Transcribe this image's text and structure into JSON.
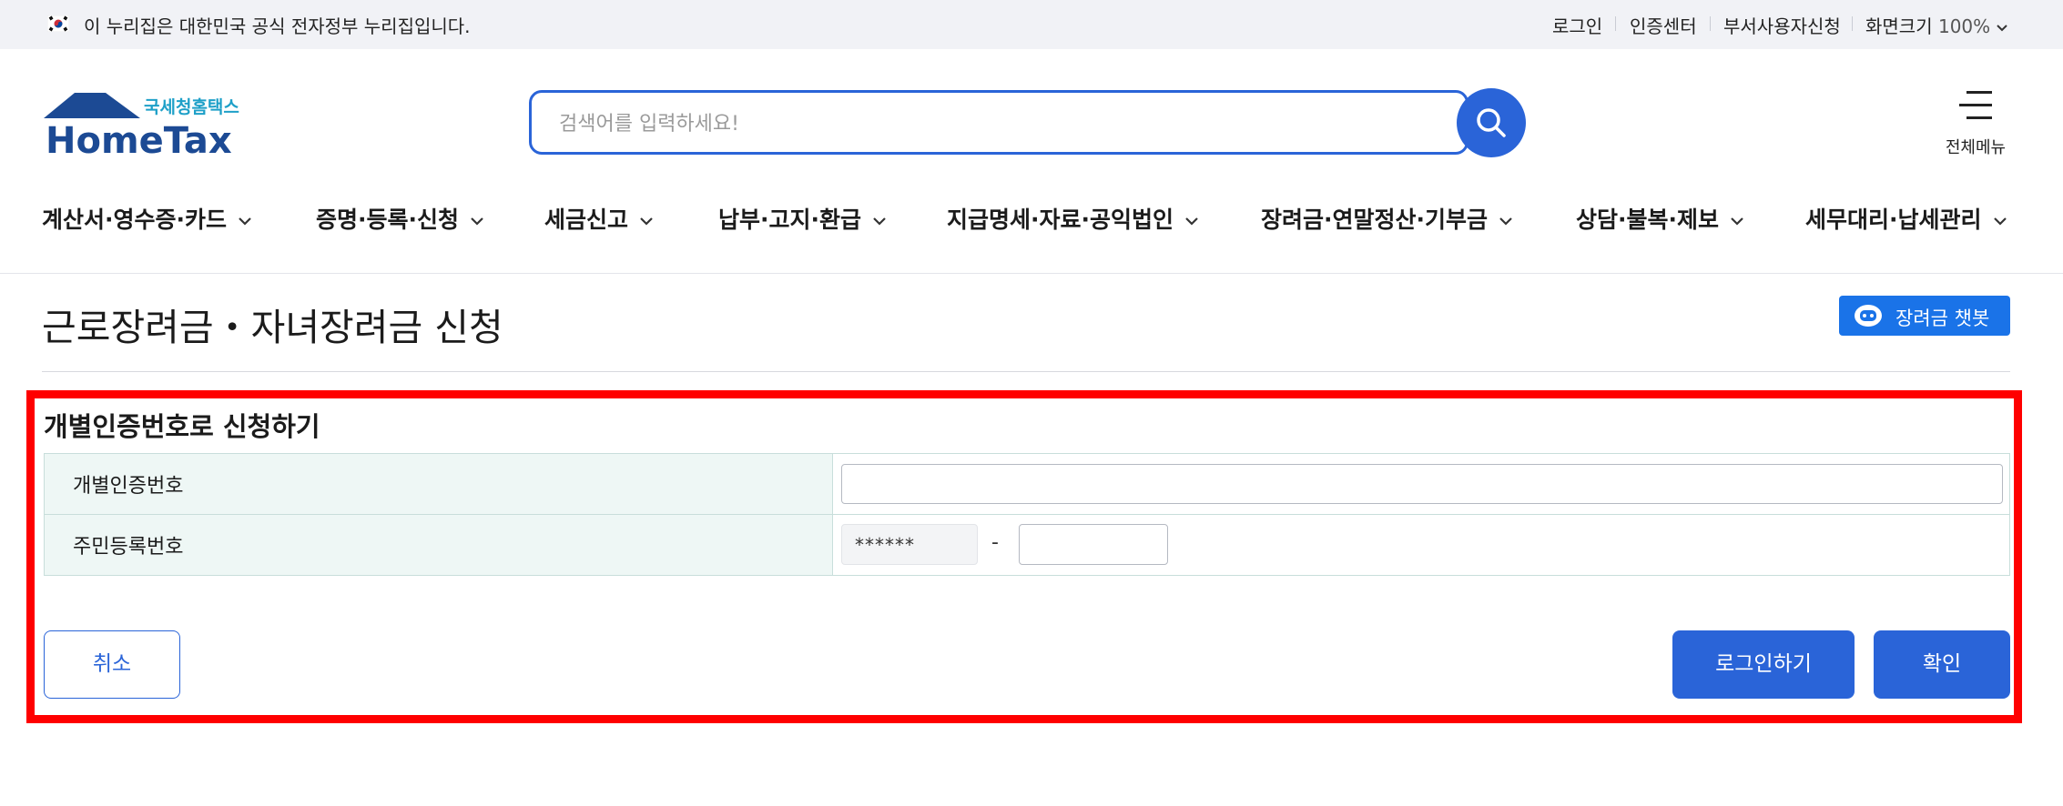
{
  "topbar": {
    "gov_notice": "이 누리집은 대한민국 공식 전자정부 누리집입니다.",
    "links": [
      "로그인",
      "인증센터",
      "부서사용자신청"
    ],
    "zoom_label": "화면크기",
    "zoom_value": "100%"
  },
  "header": {
    "logo_kr": "국세청홈택스",
    "logo_en": "HomeTax",
    "search_placeholder": "검색어를 입력하세요!",
    "menu_label": "전체메뉴"
  },
  "gnb": {
    "items": [
      "계산서·영수증·카드",
      "증명·등록·신청",
      "세금신고",
      "납부·고지·환급",
      "지급명세·자료·공익법인",
      "장려금·연말정산·기부금",
      "상담·불복·제보",
      "세무대리·납세관리"
    ]
  },
  "page": {
    "title": "근로장려금・자녀장려금 신청",
    "chatbot_label": "장려금 챗봇"
  },
  "form": {
    "section_title": "개별인증번호로 신청하기",
    "rows": [
      {
        "label": "개별인증번호"
      },
      {
        "label": "주민등록번호",
        "front_value": "******",
        "separator": "-"
      }
    ],
    "buttons": {
      "cancel": "취소",
      "login": "로그인하기",
      "confirm": "확인"
    }
  },
  "colors": {
    "primary": "#2a64d8",
    "chatbot": "#1a73e8",
    "highlight": "#ff0000",
    "table_header_bg": "#eef7f5",
    "topbar_bg": "#f1f2f6"
  }
}
